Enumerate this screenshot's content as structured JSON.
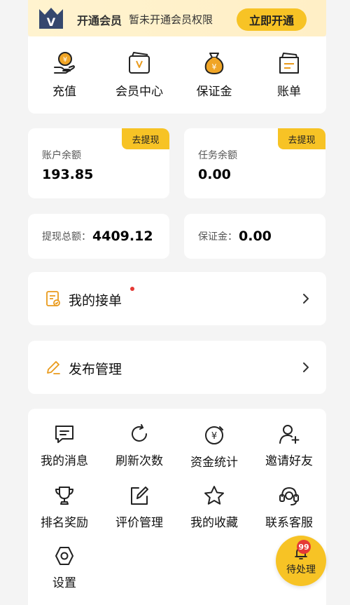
{
  "vip": {
    "title": "开通会员",
    "desc": "暂未开通会员权限",
    "button": "立即开通",
    "logo_letter": "V"
  },
  "quick_actions": [
    {
      "label": "充值",
      "icon": "recharge-icon"
    },
    {
      "label": "会员中心",
      "icon": "member-center-icon"
    },
    {
      "label": "保证金",
      "icon": "deposit-bag-icon"
    },
    {
      "label": "账单",
      "icon": "bill-icon"
    }
  ],
  "balances": {
    "account": {
      "label": "账户余额",
      "value": "193.85",
      "tag": "去提现"
    },
    "task": {
      "label": "任务余额",
      "value": "0.00",
      "tag": "去提现"
    }
  },
  "totals": {
    "withdraw": {
      "label": "提现总额：",
      "value": "4409.12"
    },
    "deposit": {
      "label": "保证金：",
      "value": "0.00"
    }
  },
  "rows": {
    "my_orders": "我的接单",
    "publish": "发布管理"
  },
  "grid": [
    {
      "label": "我的消息",
      "icon": "message-icon"
    },
    {
      "label": "刷新次数",
      "icon": "refresh-icon"
    },
    {
      "label": "资金统计",
      "icon": "fund-stats-icon"
    },
    {
      "label": "邀请好友",
      "icon": "invite-friend-icon"
    },
    {
      "label": "排名奖励",
      "icon": "trophy-icon"
    },
    {
      "label": "评价管理",
      "icon": "edit-review-icon"
    },
    {
      "label": "我的收藏",
      "icon": "star-icon"
    },
    {
      "label": "联系客服",
      "icon": "headset-icon"
    },
    {
      "label": "设置",
      "icon": "settings-icon"
    }
  ],
  "pending": {
    "label": "待处理",
    "badge": "99"
  },
  "colors": {
    "accent": "#f7c325",
    "vip_bg": "#fff3cf",
    "dot": "#e53935",
    "icon_orange": "#e99a1b"
  }
}
